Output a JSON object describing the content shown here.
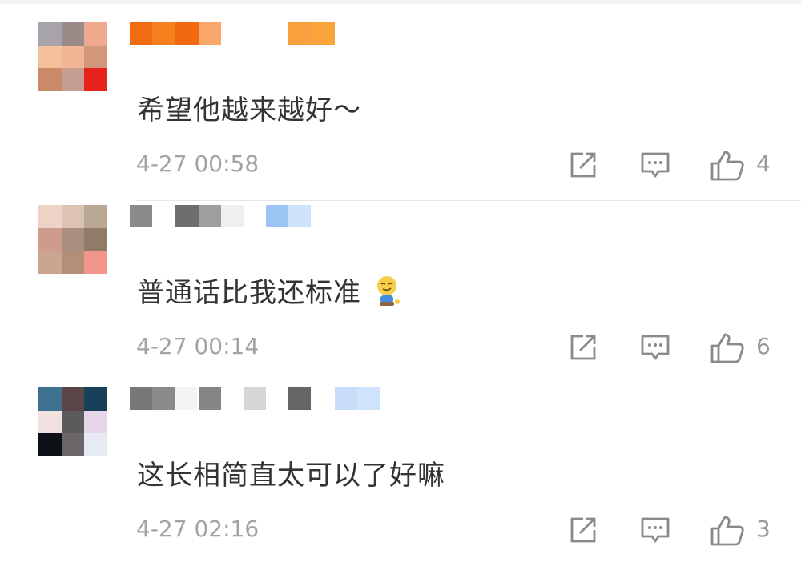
{
  "comments": [
    {
      "text": "希望他越来越好～",
      "time": "4-27 00:58",
      "likes": "4",
      "avatar_colors": [
        "#a6a3aa",
        "#9a8a88",
        "#f0a88e",
        "#f4c09a",
        "#f0b592",
        "#d0977a",
        "#ca8a6a",
        "#c79f92",
        "#e5231a"
      ],
      "name_blocks": [
        "#f36b10",
        "#f7801e",
        "#f26a10",
        "#f9a76a",
        "#f9a03e",
        "#f9a43a"
      ]
    },
    {
      "text": "普通话比我还标准",
      "time": "4-27 00:14",
      "likes": "6",
      "avatar_colors": [
        "#edd2c8",
        "#dcc3b2",
        "#b9a893",
        "#cf9b8d",
        "#a88f80",
        "#8f7b66",
        "#cba592",
        "#b48e77",
        "#f2958a"
      ],
      "name_blocks": [
        "#8a8a8a",
        "#6e6e6e",
        "#9e9e9e",
        "#efefef",
        "#9cc4f4",
        "#cfe2fb"
      ]
    },
    {
      "text": "这长相简直太可以了好嘛",
      "time": "4-27 02:16",
      "likes": "3",
      "avatar_colors": [
        "#3e7290",
        "#5a4648",
        "#184058",
        "#f1e2e1",
        "#5b5a5d",
        "#e6d6e8",
        "#0d1218",
        "#6b6669",
        "#e6eaf3"
      ],
      "name_blocks": [
        "#777777",
        "#8a8a8a",
        "#f4f4f4",
        "#858585",
        "#d6d6d6",
        "#666666",
        "#c6dcf8",
        "#cfe3fb"
      ]
    }
  ],
  "icons": {
    "share": "share-icon",
    "reply": "comment-icon",
    "like": "thumbs-up-icon",
    "emoji": "smirk-emoji-icon"
  }
}
